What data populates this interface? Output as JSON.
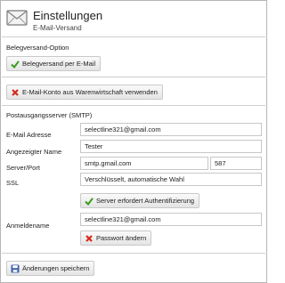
{
  "header": {
    "title": "Einstellungen",
    "subtitle": "E-Mail-Versand"
  },
  "belegversand": {
    "section_label": "Belegversand-Option",
    "option_button": "Belegversand per E-Mail"
  },
  "konto": {
    "use_erp_account_button": "E-Mail-Konto aus Warenwirtschaft verwenden"
  },
  "smtp": {
    "section_label": "Postausgangsserver (SMTP)",
    "email_label": "E-Mail Adresse",
    "email_value": "selectline321@gmail.com",
    "display_name_label": "Angezeigter Name",
    "display_name_value": "Tester",
    "server_port_label": "Server/Port",
    "server_value": "smtp.gmail.com",
    "port_value": "587",
    "ssl_label": "SSL",
    "ssl_value": "Verschlüsselt, automatische Wahl",
    "auth_button": "Server erfordert Authentifizierung",
    "login_label": "Anmeldename",
    "login_value": "selectline321@gmail.com",
    "change_password_button": "Passwort ändern"
  },
  "footer": {
    "save_button": "Änderungen speichern"
  },
  "colors": {
    "check_green": "#3a9a1e",
    "cross_red": "#d42a1e",
    "save_blue": "#3b5fa8"
  }
}
